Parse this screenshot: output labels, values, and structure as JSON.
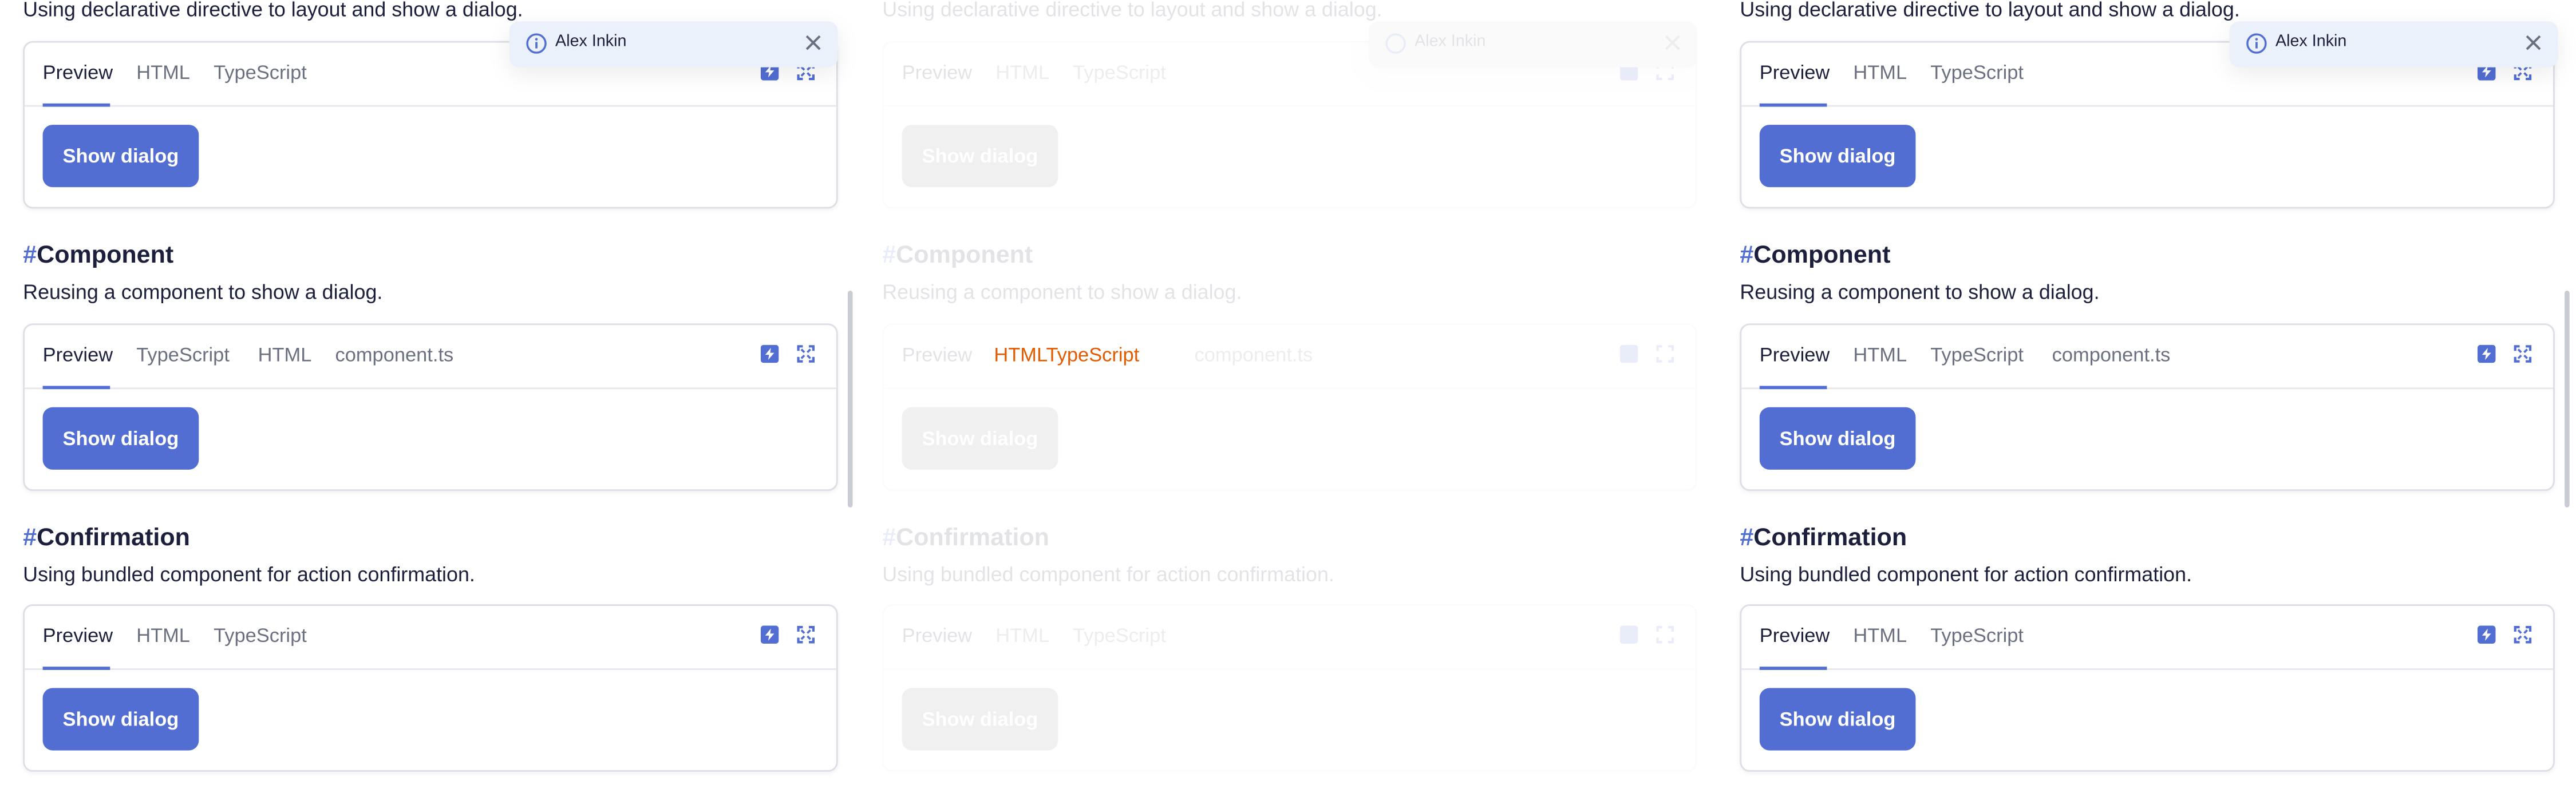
{
  "intro_text": "Using declarative directive to layout and show a dialog.",
  "notification": {
    "name": "Alex Inkin"
  },
  "show_button_label": "Show dialog",
  "sections": [
    {
      "tabs": [
        "Preview",
        "HTML",
        "TypeScript"
      ]
    },
    {
      "hash": "#",
      "title": "Component",
      "description": "Reusing a component to show a dialog.",
      "tabs_left": [
        "Preview",
        "TypeScript",
        "HTML",
        "component.ts"
      ],
      "tabs_right": [
        "Preview",
        "HTML",
        "TypeScript",
        "component.ts"
      ]
    },
    {
      "hash": "#",
      "title": "Confirmation",
      "description": "Using bundled component for action confirmation.",
      "tabs": [
        "Preview",
        "HTML",
        "TypeScript"
      ]
    }
  ],
  "overlay_glitch_text": "HTMLTypeScript",
  "colors": {
    "accent": "#526ed3",
    "text": "#1b1f3b",
    "muted_tab": "#6b7080",
    "notification_bg": "#eaf1fb",
    "glitch": "#e25b00"
  },
  "icons": [
    "info-icon",
    "close-icon",
    "stackblitz-icon",
    "fullscreen-icon"
  ]
}
